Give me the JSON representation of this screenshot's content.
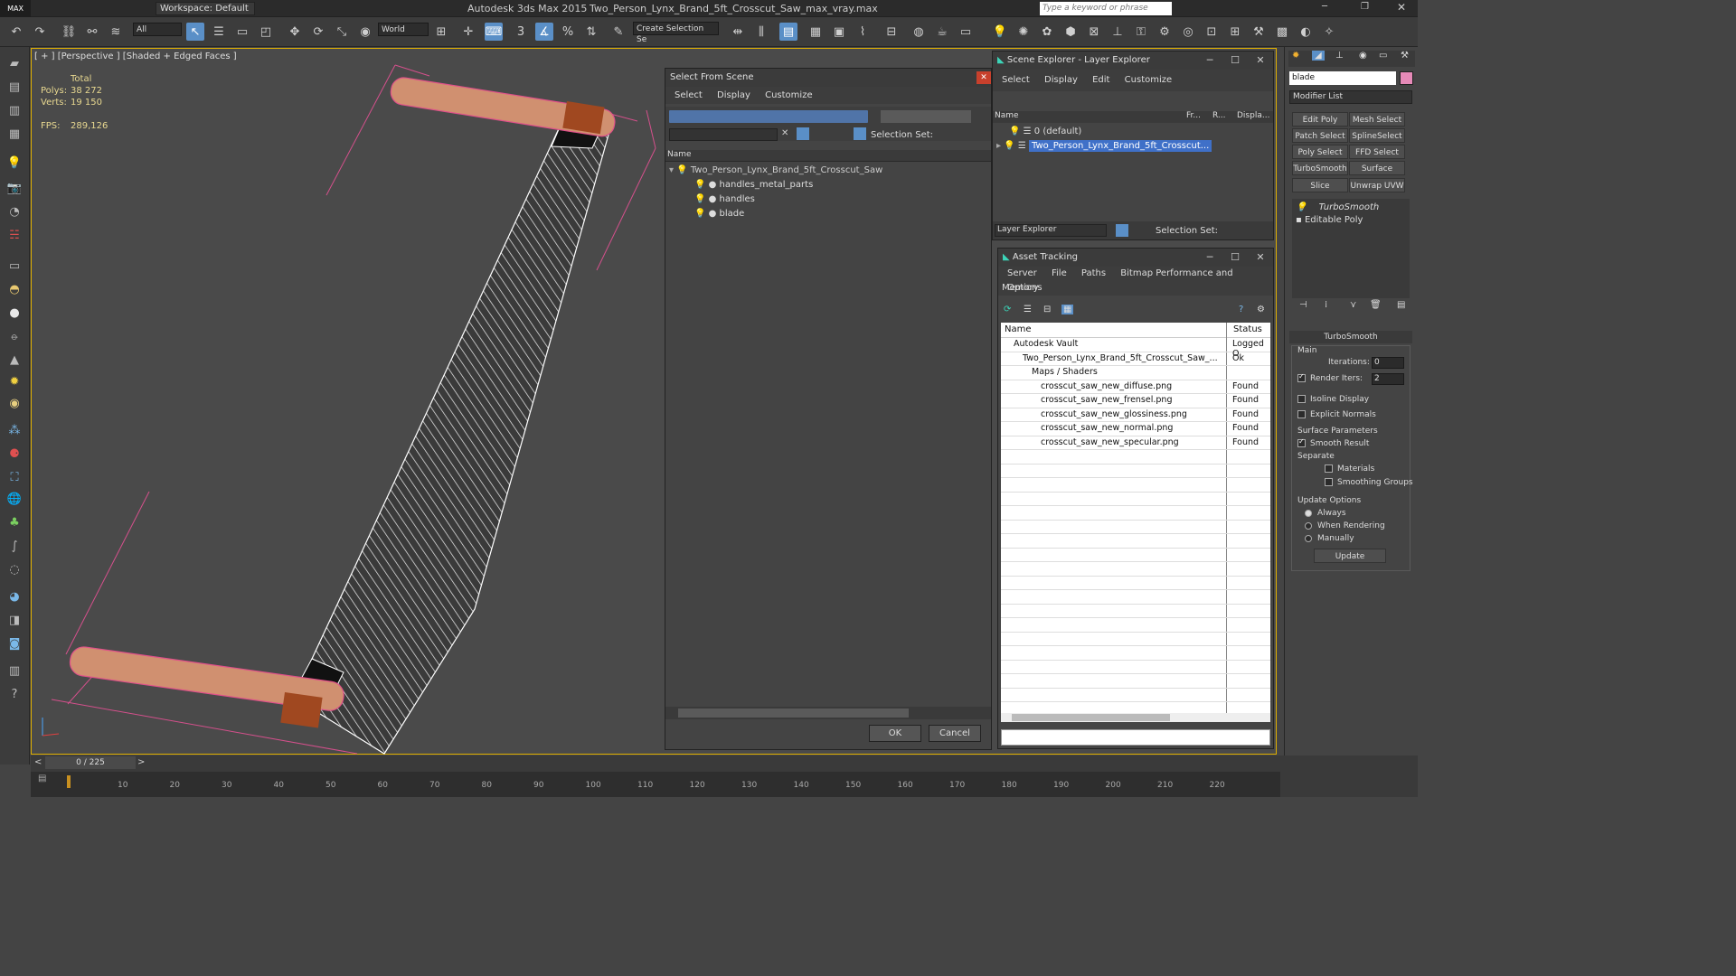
{
  "app": {
    "title": "Autodesk 3ds Max  2015",
    "file": "Two_Person_Lynx_Brand_5ft_Crosscut_Saw_max_vray.max",
    "workspace": "Workspace: Default",
    "search_placeholder": "Type a keyword or phrase",
    "logo": "MAX"
  },
  "toolbar": {
    "filter": "All",
    "coord": "World",
    "selection_set": "Create Selection Se",
    "snap": "3",
    "angle": "%"
  },
  "viewport": {
    "label": "[ + ] [Perspective ] [Shaded + Edged Faces ]",
    "stats_header": "Total",
    "polys_label": "Polys:",
    "polys": "38 272",
    "verts_label": "Verts:",
    "verts": "19 150",
    "fps_label": "FPS:",
    "fps": "289,126"
  },
  "select_dialog": {
    "title": "Select From Scene",
    "menu": [
      "Select",
      "Display",
      "Customize"
    ],
    "selection_set_label": "Selection Set:",
    "col_name": "Name",
    "root": "Two_Person_Lynx_Brand_5ft_Crosscut_Saw",
    "children": [
      "handles_metal_parts",
      "handles",
      "blade"
    ],
    "ok": "OK",
    "cancel": "Cancel"
  },
  "scene_explorer": {
    "title": "Scene Explorer - Layer Explorer",
    "menu": [
      "Select",
      "Display",
      "Edit",
      "Customize"
    ],
    "cols": [
      "Name",
      "Fr...",
      "R...",
      "Displa..."
    ],
    "rows": [
      "0 (default)",
      "Two_Person_Lynx_Brand_5ft_Crosscut..."
    ],
    "footer_dropdown": "Layer Explorer",
    "selection_set_label": "Selection Set:"
  },
  "asset_tracking": {
    "title": "Asset Tracking",
    "menu": [
      "Server",
      "File",
      "Paths",
      "Bitmap Performance and Memory"
    ],
    "menu2": "Options",
    "cols": [
      "Name",
      "Status"
    ],
    "rows": [
      {
        "name": "Autodesk Vault",
        "status": "Logged O",
        "indent": 1
      },
      {
        "name": "Two_Person_Lynx_Brand_5ft_Crosscut_Saw_...",
        "status": "Ok",
        "indent": 2
      },
      {
        "name": "Maps / Shaders",
        "status": "",
        "indent": 3
      },
      {
        "name": "crosscut_saw_new_diffuse.png",
        "status": "Found",
        "indent": 4
      },
      {
        "name": "crosscut_saw_new_frensel.png",
        "status": "Found",
        "indent": 4
      },
      {
        "name": "crosscut_saw_new_glossiness.png",
        "status": "Found",
        "indent": 4
      },
      {
        "name": "crosscut_saw_new_normal.png",
        "status": "Found",
        "indent": 4
      },
      {
        "name": "crosscut_saw_new_specular.png",
        "status": "Found",
        "indent": 4
      }
    ]
  },
  "command_panel": {
    "object_name": "blade",
    "modifier_list": "Modifier List",
    "buttons": [
      "Edit Poly",
      "Mesh Select",
      "Patch Select",
      "SplineSelect",
      "Poly Select",
      "FFD Select",
      "TurboSmooth",
      "Surface Select",
      "Slice",
      "Unwrap UVW"
    ],
    "stack": [
      "TurboSmooth",
      "Editable Poly"
    ],
    "rollout": "TurboSmooth",
    "main": "Main",
    "iterations_label": "Iterations:",
    "iterations": "0",
    "render_iters_label": "Render Iters:",
    "render_iters": "2",
    "isoline": "Isoline Display",
    "explicit": "Explicit Normals",
    "surface_params": "Surface Parameters",
    "smooth_result": "Smooth Result",
    "separate": "Separate",
    "materials": "Materials",
    "smoothing_groups": "Smoothing Groups",
    "update_options": "Update Options",
    "always": "Always",
    "when_rendering": "When Rendering",
    "manually": "Manually",
    "update": "Update"
  },
  "timeline": {
    "frame": "0 / 225",
    "ticks": [
      "10",
      "20",
      "30",
      "40",
      "50",
      "60",
      "70",
      "80",
      "90",
      "100",
      "110",
      "120",
      "130",
      "140",
      "150",
      "160",
      "170",
      "180",
      "190",
      "200",
      "210",
      "220"
    ]
  }
}
